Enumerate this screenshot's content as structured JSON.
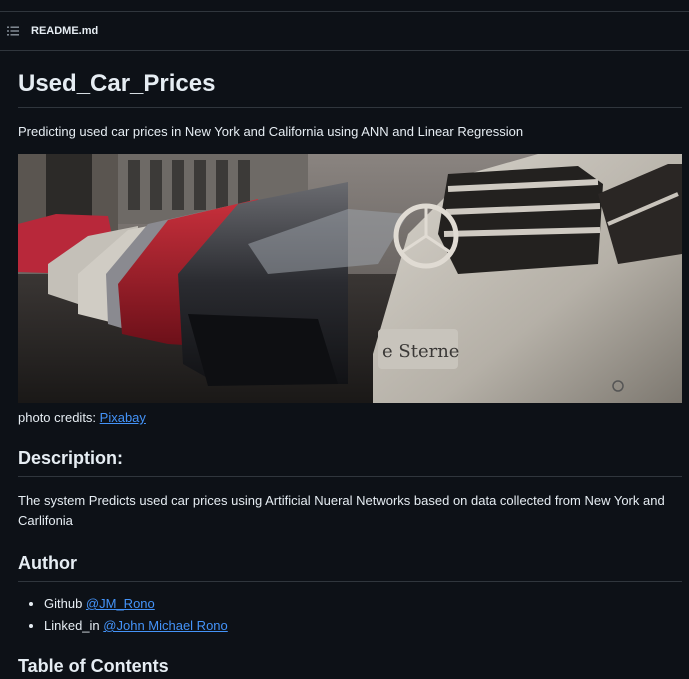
{
  "header": {
    "file_name": "README.md",
    "menu_icon": "list-icon"
  },
  "readme": {
    "title": "Used_Car_Prices",
    "subtitle": "Predicting used car prices in New York and California using ANN and Linear Regression",
    "image_sign_text": "e Sterne",
    "credits_prefix": "photo credits: ",
    "credits_link": "Pixabay",
    "description_heading": "Description:",
    "description_text": "The system Predicts used car prices using Artificial Nueral Networks based on data collected from New York and Carlifonia",
    "author_heading": "Author",
    "author_items": [
      {
        "label": "Github ",
        "link": "@JM_Rono"
      },
      {
        "label": "Linked_in ",
        "link": "@John Michael Rono"
      }
    ],
    "toc_heading": "Table of Contents"
  },
  "colors": {
    "background": "#0d1117",
    "border": "#30363d",
    "text": "#e6edf3",
    "link": "#4493f8"
  }
}
